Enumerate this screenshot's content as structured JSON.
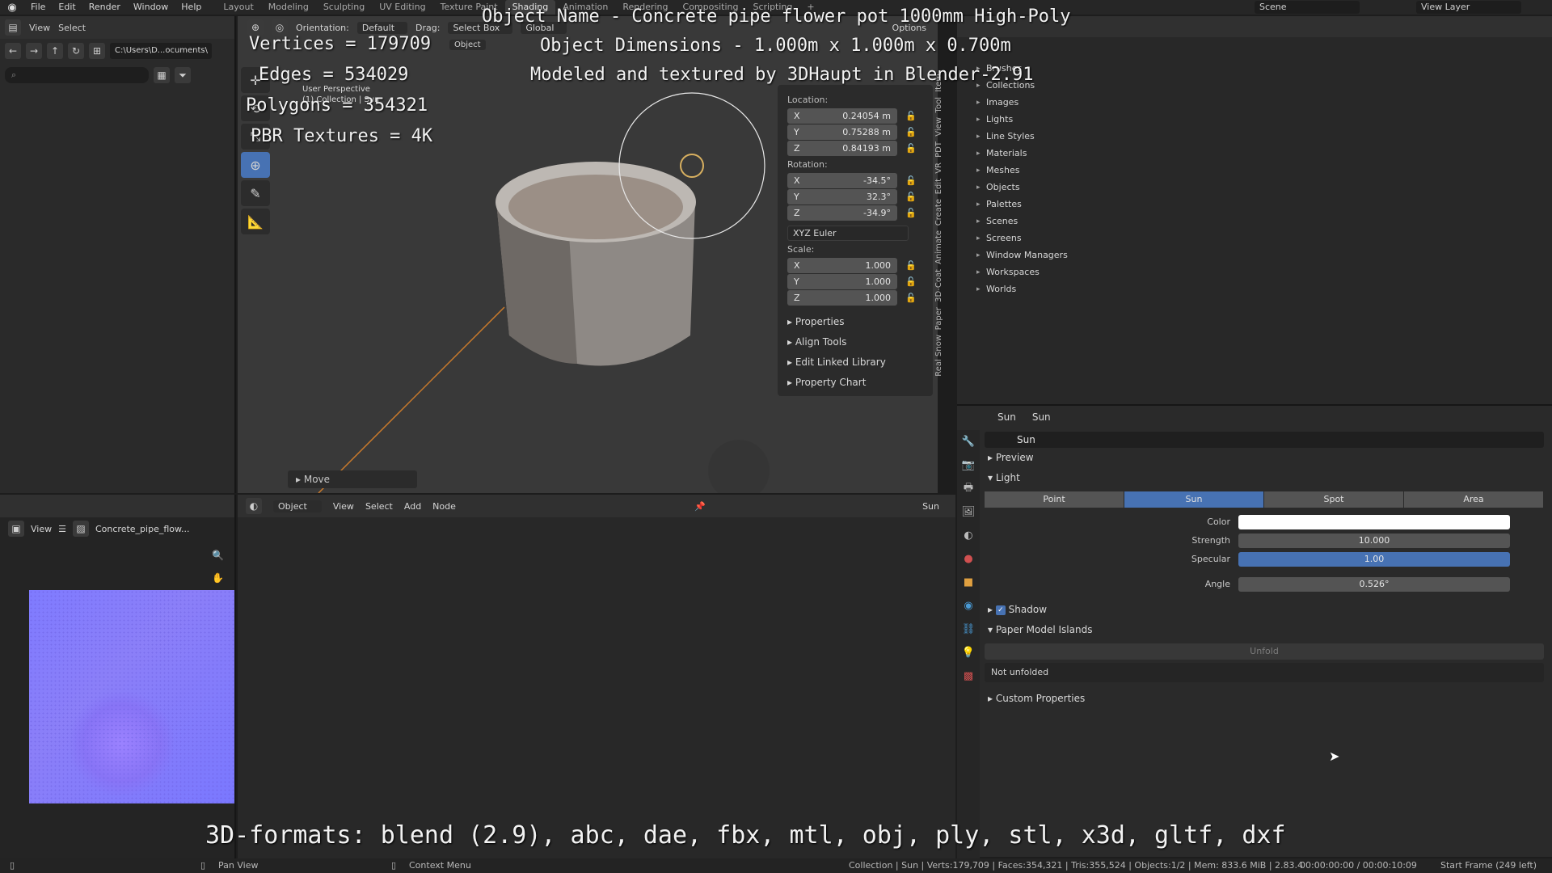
{
  "menu": [
    "File",
    "Edit",
    "Render",
    "Window",
    "Help"
  ],
  "workspace_tabs": [
    "Layout",
    "Modeling",
    "Sculpting",
    "UV Editing",
    "Texture Paint",
    "Shading",
    "Animation",
    "Rendering",
    "Compositing",
    "Scripting"
  ],
  "active_workspace": "Shading",
  "scene": "Scene",
  "view_layer": "View Layer",
  "file_browser": {
    "menu": [
      "View",
      "Select"
    ],
    "path": "C:\\Users\\D...ocuments\\"
  },
  "viewport": {
    "orientation_label": "Orientation:",
    "orientation": "Default",
    "drag_label": "Drag:",
    "drag": "Select Box",
    "transform": "Global",
    "options": "Options",
    "mode": "Object",
    "view_name": "User Perspective",
    "collection": "(1) Collection | Sun",
    "last_op": "Move"
  },
  "overlay": {
    "line1": "Object Name - Concrete pipe flower pot 1000mm High-Poly",
    "line2": "Object Dimensions - 1.000m x 1.000m x 0.700m",
    "line3": "Modeled and textured by 3DHaupt in Blender-2.91",
    "vertices": "Vertices = 179709",
    "edges": "Edges = 534029",
    "polygons": "Polygons = 354321",
    "textures": "PBR Textures = 4K",
    "formats": "3D-formats: blend (2.9), abc, dae, fbx, mtl, obj, ply, stl, x3d, gltf, dxf"
  },
  "npanel": {
    "location_label": "Location:",
    "location": {
      "x": "0.24054 m",
      "y": "0.75288 m",
      "z": "0.84193 m"
    },
    "rotation_label": "Rotation:",
    "rotation": {
      "x": "-34.5°",
      "y": "32.3°",
      "z": "-34.9°"
    },
    "rotation_mode": "XYZ Euler",
    "scale_label": "Scale:",
    "scale": {
      "x": "1.000",
      "y": "1.000",
      "z": "1.000"
    },
    "sections": [
      "Properties",
      "Align Tools",
      "Edit Linked Library",
      "Property Chart"
    ],
    "vtabs": [
      "Item",
      "Tool",
      "View",
      "PDT",
      "VR",
      "Edit",
      "Create",
      "Animate",
      "3D-Coat",
      "Paper",
      "Real Snow"
    ]
  },
  "outliner": {
    "items": [
      "Brushes",
      "Collections",
      "Images",
      "Lights",
      "Line Styles",
      "Materials",
      "Meshes",
      "Objects",
      "Palettes",
      "Scenes",
      "Screens",
      "Window Managers",
      "Workspaces",
      "Worlds"
    ]
  },
  "properties": {
    "header_obj": "Sun",
    "header_data": "Sun",
    "datablock": "Sun",
    "preview": "Preview",
    "light": "Light",
    "light_types": [
      "Point",
      "Sun",
      "Spot",
      "Area"
    ],
    "active_light_type": "Sun",
    "color_label": "Color",
    "strength_label": "Strength",
    "strength": "10.000",
    "specular_label": "Specular",
    "specular": "1.00",
    "angle_label": "Angle",
    "angle": "0.526°",
    "shadow": "Shadow",
    "paper_model": "Paper Model Islands",
    "unfold": "Unfold",
    "not_unfolded": "Not unfolded",
    "custom_props": "Custom Properties"
  },
  "node_editor": {
    "mode": "Object",
    "menu": [
      "View",
      "Select",
      "Add",
      "Node"
    ],
    "slot": "Sun"
  },
  "image_editor": {
    "view": "View",
    "image_name": "Concrete_pipe_flow..."
  },
  "statusbar": {
    "pan": "Pan View",
    "context": "Context Menu",
    "stats": "Collection | Sun | Verts:179,709 | Faces:354,321 | Tris:355,524 | Objects:1/2 | Mem: 833.6 MiB | 2.83.4",
    "time": "00:00:00:00 / 00:00:10:09",
    "frame": "Start Frame (249 left)"
  }
}
